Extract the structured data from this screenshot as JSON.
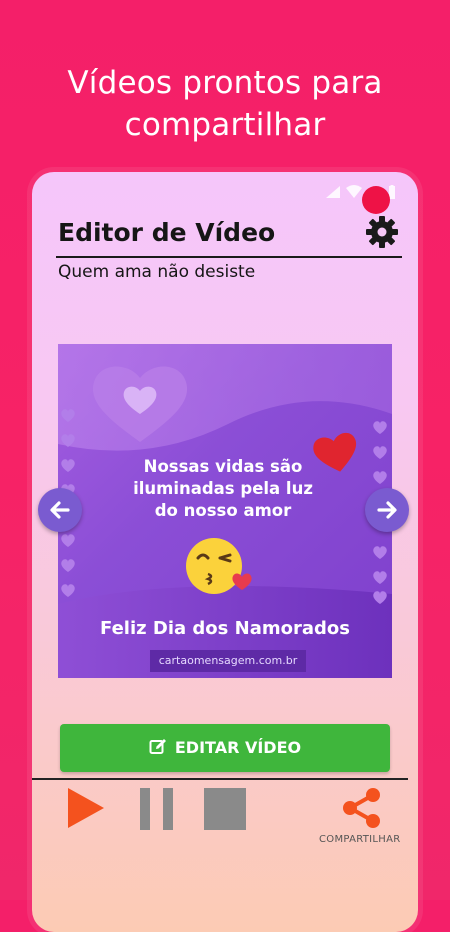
{
  "promo": {
    "line1": "Vídeos prontos para",
    "line2": "compartilhar"
  },
  "app": {
    "title": "Editor de Vídeo",
    "subtitle": "Quem ama não desiste"
  },
  "card": {
    "message_line1": "Nossas vidas são",
    "message_line2": "iluminadas pela luz",
    "message_line3": "do nosso amor",
    "greeting": "Feliz Dia dos Namorados",
    "website": "cartaomensagem.com.br"
  },
  "actions": {
    "edit_label": "EDITAR VÍDEO",
    "share_label": "COMPARTILHAR"
  },
  "colors": {
    "background": "#f41f69",
    "edit_button": "#3fb63c",
    "play": "#f4521e",
    "share": "#f4521e",
    "record_dot": "#ee1246",
    "nav_button": "#7a5bd0"
  },
  "icons": [
    "gear-icon",
    "arrow-left-icon",
    "arrow-right-icon",
    "edit-icon",
    "play-icon",
    "pause-icon",
    "stop-icon",
    "share-icon"
  ]
}
